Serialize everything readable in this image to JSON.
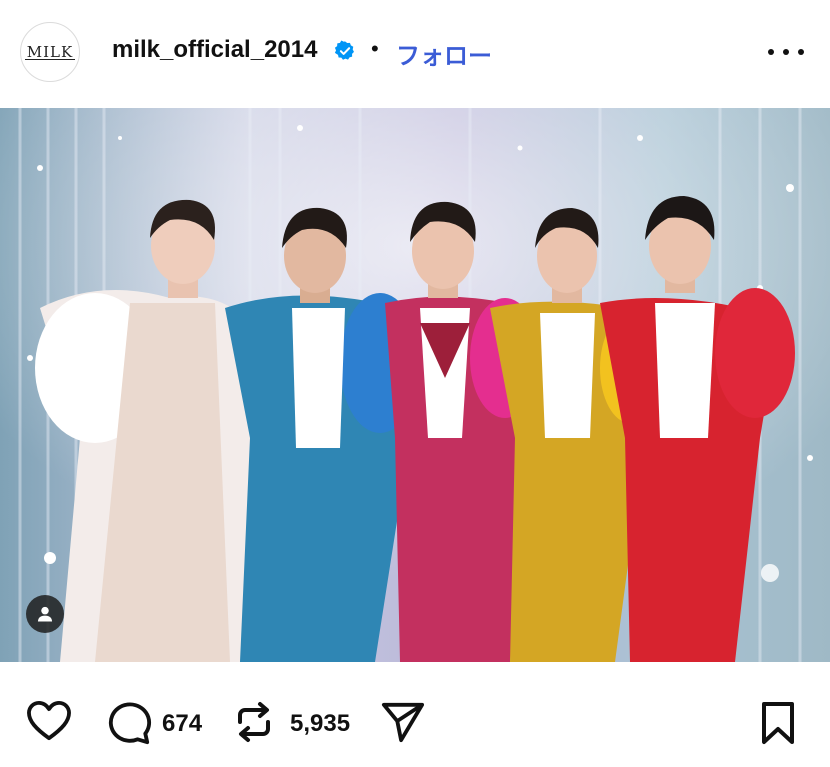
{
  "post": {
    "avatar_text": "MILK",
    "username": "milk_official_2014",
    "separator": "•",
    "follow_label": "フォロー",
    "verified_color": "#0095f6",
    "follow_color": "#3b5cd6"
  },
  "photo": {
    "description_icon": "user-tag-icon"
  },
  "actions": {
    "like_icon": "heart-icon",
    "comment_icon": "comment-icon",
    "comment_count": "674",
    "repost_icon": "repost-icon",
    "repost_count": "5,935",
    "share_icon": "send-icon",
    "save_icon": "bookmark-icon"
  }
}
